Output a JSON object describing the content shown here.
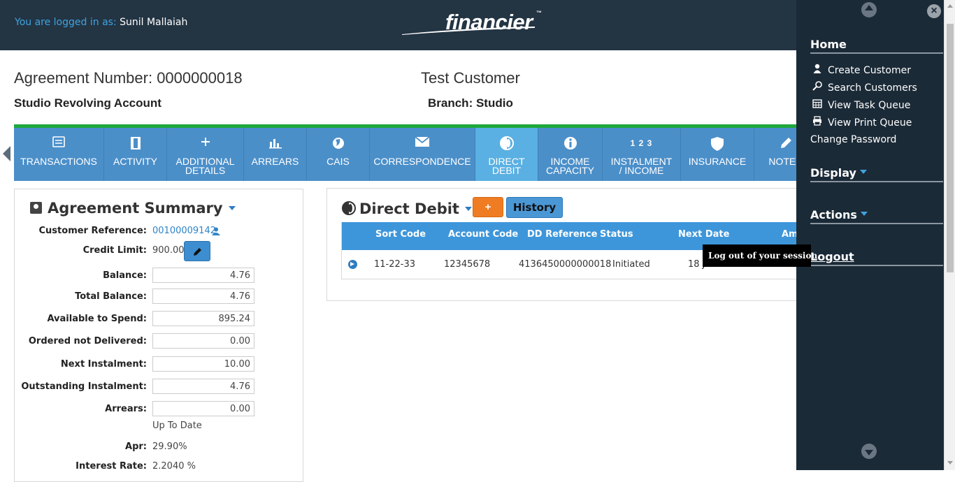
{
  "header": {
    "logged_prefix": "You are logged in as: ",
    "user_name": "Sunil Mallaiah",
    "logo_text": "financier",
    "logo_tm": "™"
  },
  "agreement": {
    "number_label": "Agreement Number: 0000000018",
    "type": "Studio Revolving Account",
    "customer": "Test Customer",
    "branch": "Branch: Studio"
  },
  "tabs": [
    {
      "line1": "TRANSACTIONS",
      "line2": "",
      "icon": "list-icon"
    },
    {
      "line1": "ACTIVITY",
      "line2": "",
      "icon": "film-icon"
    },
    {
      "line1": "ADDITIONAL",
      "line2": "DETAILS",
      "icon": "plus-icon"
    },
    {
      "line1": "ARREARS",
      "line2": "",
      "icon": "chart-icon"
    },
    {
      "line1": "CAIS",
      "line2": "",
      "icon": "globe-icon"
    },
    {
      "line1": "CORRESPONDENCE",
      "line2": "",
      "icon": "envelope-icon"
    },
    {
      "line1": "DIRECT",
      "line2": "DEBIT",
      "icon": "contrast-icon"
    },
    {
      "line1": "INCOME",
      "line2": "CAPACITY",
      "icon": "info-icon"
    },
    {
      "line1": "INSTALMENT",
      "line2": "/ INCOME",
      "icon": "numbers-icon",
      "icon_text": "1 2 3"
    },
    {
      "line1": "INSURANCE",
      "line2": "",
      "icon": "shield-icon"
    },
    {
      "line1": "NOTES",
      "line2": "",
      "icon": "pencil-icon"
    }
  ],
  "summary": {
    "title": "Agreement Summary",
    "customer_ref_label": "Customer Reference:",
    "customer_ref_value": "00100009142",
    "credit_limit_label": "Credit Limit:",
    "credit_limit_value": "900.00",
    "fields": [
      {
        "label": "Balance:",
        "value": "4.76"
      },
      {
        "label": "Total Balance:",
        "value": "4.76"
      },
      {
        "label": "Available to Spend:",
        "value": "895.24"
      },
      {
        "label": "Ordered not Delivered:",
        "value": "0.00"
      },
      {
        "label": "Next Instalment:",
        "value": "10.00"
      },
      {
        "label": "Outstanding Instalment:",
        "value": "4.76"
      },
      {
        "label": "Arrears:",
        "value": "0.00"
      }
    ],
    "arrears_status": "Up To Date",
    "apr_label": "Apr:",
    "apr_value": "29.90%",
    "interest_label": "Interest Rate:",
    "interest_value": "2.2040 %"
  },
  "direct_debit": {
    "title": "Direct Debit",
    "add_label": "+",
    "history_label": "History",
    "columns": [
      "Sort Code",
      "Account Code",
      "DD Reference",
      "Status",
      "Next Date",
      "Am"
    ],
    "row": {
      "sort_code": "11-22-33",
      "account_code": "12345678",
      "dd_reference": "4136450000000018",
      "status": "Initiated",
      "next_date": "18 J"
    }
  },
  "tooltip": "Log out of your session",
  "side_menu": {
    "home": "Home",
    "items": [
      {
        "label": "Create Customer",
        "icon": "user-icon"
      },
      {
        "label": "Search Customers",
        "icon": "search-icon"
      },
      {
        "label": "View Task Queue",
        "icon": "calendar-icon"
      },
      {
        "label": "View Print Queue",
        "icon": "print-icon"
      }
    ],
    "change_password": "Change Password",
    "display": "Display",
    "actions": "Actions",
    "logout": "Logout",
    "close": "×"
  },
  "colors": {
    "header_bg": "#233443",
    "tab_bg": "#4b8fc9",
    "tab_active": "#5ab0e2",
    "accent_green": "#1fa73a",
    "side_menu_bg": "#1b2a37",
    "orange": "#ef7c22"
  }
}
